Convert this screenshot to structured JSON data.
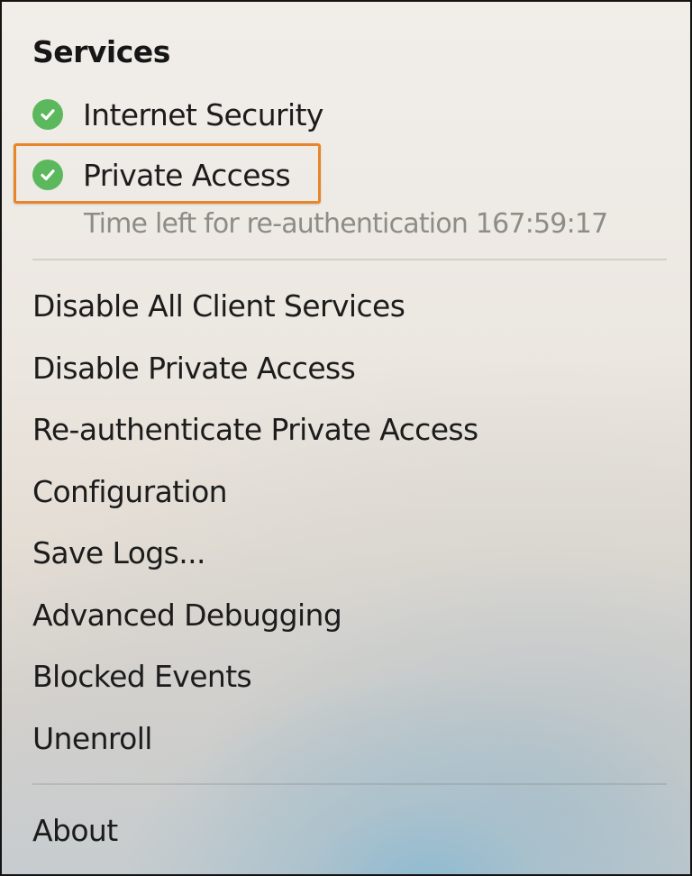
{
  "menu": {
    "section_title": "Services",
    "services": [
      {
        "label": "Internet Security",
        "status_icon": "check-circle-icon",
        "status_color": "#5cb85c"
      },
      {
        "label": "Private Access",
        "status_icon": "check-circle-icon",
        "status_color": "#5cb85c",
        "highlighted": true
      }
    ],
    "reauth_text": "Time left for re-authentication 167:59:17",
    "highlight_color": "#e8852a",
    "items": [
      {
        "label": "Disable All Client Services"
      },
      {
        "label": "Disable Private Access"
      },
      {
        "label": "Re-authenticate Private Access"
      },
      {
        "label": "Configuration"
      },
      {
        "label": "Save Logs..."
      },
      {
        "label": "Advanced Debugging"
      },
      {
        "label": "Blocked Events"
      },
      {
        "label": "Unenroll"
      }
    ],
    "footer_items": [
      {
        "label": "About"
      }
    ]
  }
}
